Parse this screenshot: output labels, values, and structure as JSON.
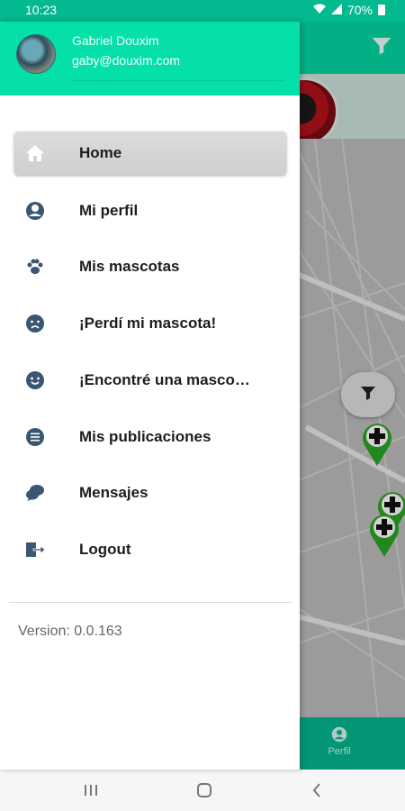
{
  "status_bar": {
    "time": "10:23",
    "battery": "70%"
  },
  "drawer": {
    "user_name": "Gabriel Douxim",
    "user_email": "gaby@douxim.com",
    "menu": [
      {
        "label": "Home",
        "icon": "home-icon",
        "active": true
      },
      {
        "label": "Mi perfil",
        "icon": "user-circle-icon"
      },
      {
        "label": "Mis mascotas",
        "icon": "paw-icon"
      },
      {
        "label": "¡Perdí mi mascota!",
        "icon": "sad-face-icon"
      },
      {
        "label": "¡Encontré una masco…",
        "icon": "smile-face-icon"
      },
      {
        "label": "Mis publicaciones",
        "icon": "list-icon"
      },
      {
        "label": "Mensajes",
        "icon": "chat-icon"
      },
      {
        "label": "Logout",
        "icon": "logout-icon"
      }
    ],
    "version": "Version: 0.0.163"
  },
  "bottom_nav": {
    "perfil_label": "Perfil"
  },
  "colors": {
    "accent": "#04e0a8",
    "accent_dark": "#04b890",
    "icon": "#3b5670",
    "pin": "#2aa524"
  }
}
